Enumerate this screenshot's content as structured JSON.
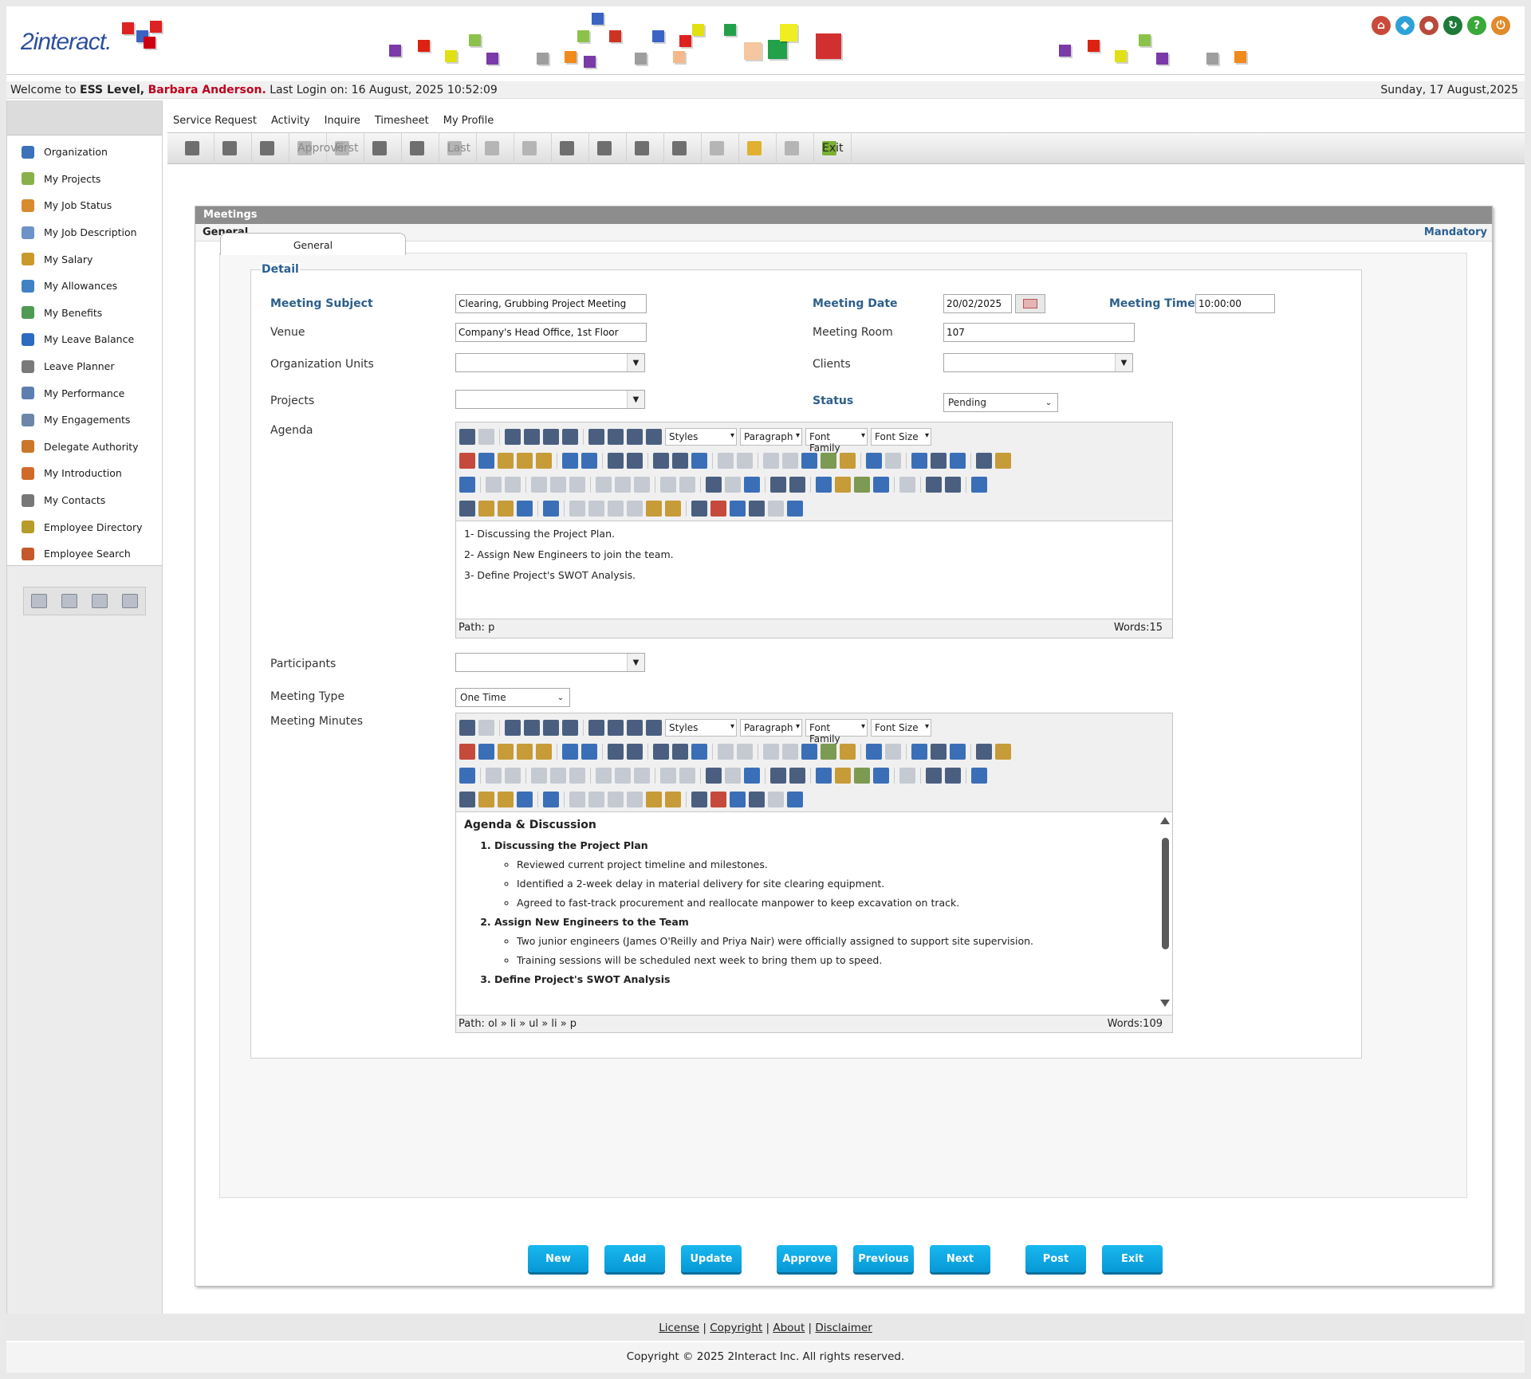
{
  "header": {
    "logo_text": "2interact.",
    "icons": [
      "home-icon",
      "network-icon",
      "user-icon",
      "refresh-icon",
      "help-icon",
      "logout-icon"
    ]
  },
  "welcome": {
    "prefix": "Welcome to",
    "level": "ESS Level,",
    "user": "Barbara Anderson.",
    "last_login": "Last Login on: 16 August, 2025 10:52:09",
    "date": "Sunday, 17 August,2025"
  },
  "menu": [
    "Service Request",
    "Activity",
    "Inquire",
    "Timesheet",
    "My Profile"
  ],
  "toolbar": {
    "approve": "Approve",
    "first": "First",
    "last": "Last",
    "exit": "Exit"
  },
  "sidebar": {
    "items": [
      {
        "label": "Organization",
        "color": "#3c72b8"
      },
      {
        "label": "My Projects",
        "color": "#88b14a"
      },
      {
        "label": "My Job Status",
        "color": "#d88a2f"
      },
      {
        "label": "My Job Description",
        "color": "#6d93c9"
      },
      {
        "label": "My Salary",
        "color": "#c99a2a"
      },
      {
        "label": "My Allowances",
        "color": "#3f83c4"
      },
      {
        "label": "My Benefits",
        "color": "#4e9a53"
      },
      {
        "label": "My Leave Balance",
        "color": "#2c6bbf"
      },
      {
        "label": "Leave Planner",
        "color": "#7a7a7a"
      },
      {
        "label": "My Performance",
        "color": "#5d7fb0"
      },
      {
        "label": "My Engagements",
        "color": "#6b86a8"
      },
      {
        "label": "Delegate Authority",
        "color": "#c9782b"
      },
      {
        "label": "My Introduction",
        "color": "#d06a2a"
      },
      {
        "label": "My Contacts",
        "color": "#777777"
      },
      {
        "label": "Employee Directory",
        "color": "#b89c2a"
      },
      {
        "label": "Employee Search",
        "color": "#c45a2a"
      }
    ]
  },
  "panel": {
    "title": "Meetings",
    "section": "General",
    "mandatory": "Mandatory",
    "tab": "General",
    "legend": "Detail"
  },
  "form": {
    "meeting_subject_label": "Meeting Subject",
    "meeting_subject": "Clearing, Grubbing Project Meeting",
    "meeting_date_label": "Meeting Date",
    "meeting_date": "20/02/2025",
    "meeting_time_label": "Meeting Time",
    "meeting_time": "10:00:00",
    "venue_label": "Venue",
    "venue": "Company's Head Office, 1st Floor",
    "meeting_room_label": "Meeting Room",
    "meeting_room": "107",
    "org_units_label": "Organization Units",
    "org_units": "",
    "clients_label": "Clients",
    "clients": "",
    "projects_label": "Projects",
    "projects": "",
    "status_label": "Status",
    "status": "Pending",
    "agenda_label": "Agenda",
    "participants_label": "Participants",
    "participants": "",
    "meeting_type_label": "Meeting Type",
    "meeting_type": "One Time",
    "minutes_label": "Meeting Minutes"
  },
  "editor": {
    "styles": "Styles",
    "paragraph": "Paragraph",
    "font_family": "Font Family",
    "font_size": "Font Size"
  },
  "agenda": {
    "lines": [
      "1- Discussing the Project Plan.",
      "2- Assign New Engineers to join the team.",
      "3- Define Project's SWOT Analysis."
    ],
    "path": "Path: p",
    "words": "Words:15"
  },
  "minutes": {
    "heading": "Agenda & Discussion",
    "item1": "Discussing the Project Plan",
    "item1_points": [
      "Reviewed current project timeline and milestones.",
      "Identified a 2-week delay in material delivery for site clearing equipment.",
      "Agreed to fast-track procurement and reallocate manpower to keep excavation on track."
    ],
    "item2": "Assign New Engineers to the Team",
    "item2_points": [
      "Two junior engineers (James O'Reilly and Priya Nair) were officially assigned to support site supervision.",
      "Training sessions will be scheduled next week to bring them up to speed."
    ],
    "item3": "Define Project's SWOT Analysis",
    "path": "Path: ol » li » ul » li » p",
    "words": "Words:109"
  },
  "buttons": [
    "New",
    "Add",
    "Update",
    "Approve",
    "Previous",
    "Next",
    "Post",
    "Exit"
  ],
  "footer": {
    "links": [
      "License",
      "Copyright",
      "About",
      "Disclaimer"
    ],
    "copyright": "Copyright © 2025 2Interact Inc. All rights reserved."
  }
}
